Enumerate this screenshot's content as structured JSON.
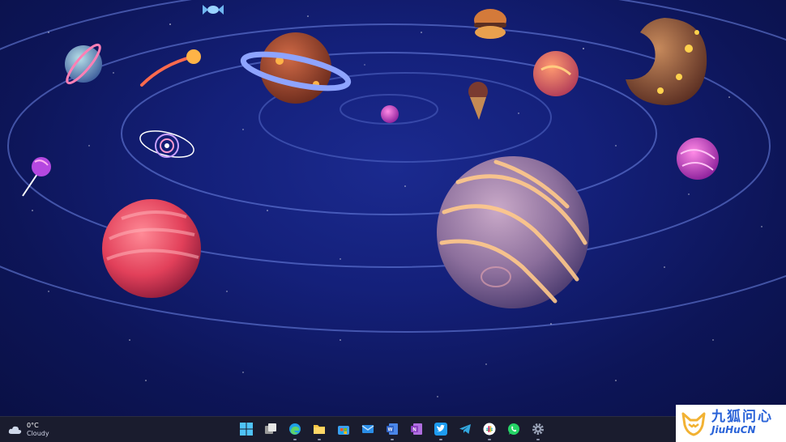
{
  "desktop": {
    "wallpaper": "space-candy-planets",
    "colors": {
      "sky_dark": "#0a1045",
      "sky_mid": "#1b2a8f",
      "orbit": "#6f86e6"
    }
  },
  "taskbar": {
    "weather": {
      "icon": "cloud-icon",
      "temperature": "0°C",
      "condition": "Cloudy"
    },
    "apps": [
      {
        "name": "start-button",
        "icon": "windows-logo-icon",
        "color": "#4fc3f7"
      },
      {
        "name": "task-view-button",
        "icon": "task-view-icon",
        "color": "#d0d0d0"
      },
      {
        "name": "edge-button",
        "icon": "edge-icon",
        "color": "#1fa0e6",
        "running": true
      },
      {
        "name": "file-explorer-button",
        "icon": "folder-icon",
        "color": "#f7c544",
        "running": true
      },
      {
        "name": "store-button",
        "icon": "store-icon",
        "color": "#3aa0f0"
      },
      {
        "name": "mail-button",
        "icon": "mail-icon",
        "color": "#2a8de8"
      },
      {
        "name": "word-button",
        "icon": "word-icon",
        "color": "#2b5fc4",
        "running": true
      },
      {
        "name": "onenote-button",
        "icon": "onenote-icon",
        "color": "#8b3fc2"
      },
      {
        "name": "twitter-button",
        "icon": "twitter-icon",
        "color": "#1d9bf0",
        "running": true
      },
      {
        "name": "telegram-button",
        "icon": "telegram-icon",
        "color": "#33a8e0"
      },
      {
        "name": "slack-button",
        "icon": "slack-icon",
        "color": "#ffffff",
        "running": true
      },
      {
        "name": "whatsapp-button",
        "icon": "whatsapp-icon",
        "color": "#25d366"
      },
      {
        "name": "settings-button",
        "icon": "gear-icon",
        "color": "#9aa3b8",
        "running": true
      }
    ]
  },
  "watermark": {
    "text_cn": "九狐问心",
    "text_en": "JiuHuCN",
    "logo": "fox-logo-icon"
  }
}
